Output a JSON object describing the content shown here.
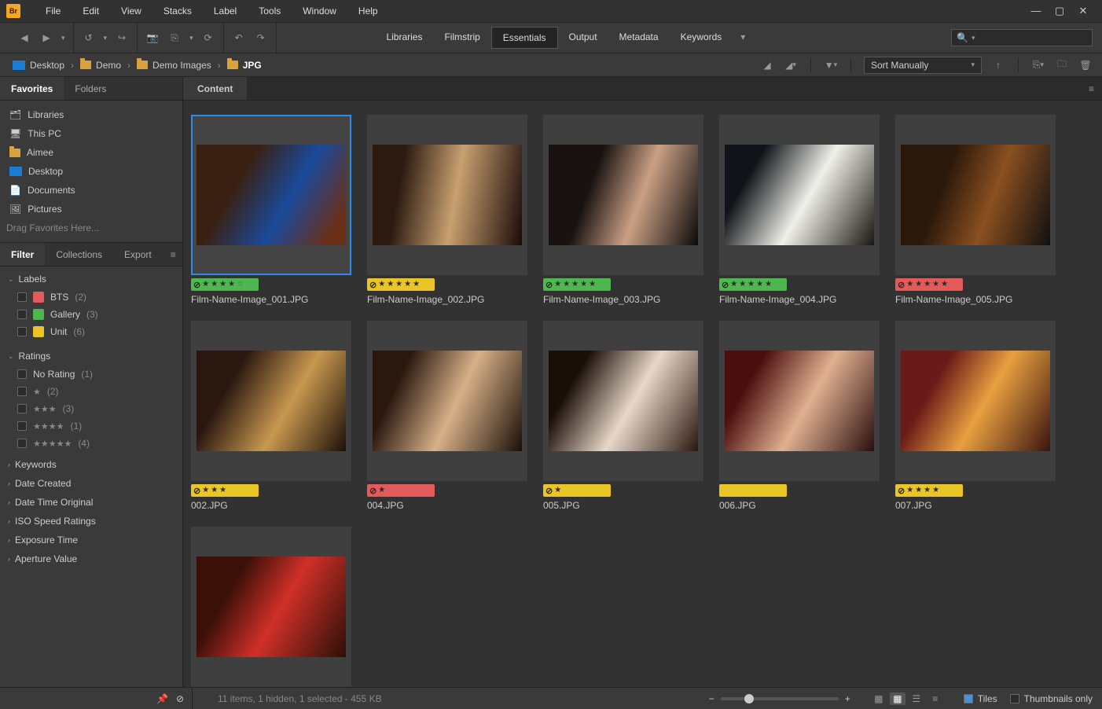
{
  "menubar": {
    "items": [
      "File",
      "Edit",
      "View",
      "Stacks",
      "Label",
      "Tools",
      "Window",
      "Help"
    ]
  },
  "workspaces": {
    "items": [
      "Libraries",
      "Filmstrip",
      "Essentials",
      "Output",
      "Metadata",
      "Keywords"
    ],
    "active": "Essentials"
  },
  "breadcrumb": [
    {
      "icon": "desktop",
      "label": "Desktop"
    },
    {
      "icon": "folder",
      "label": "Demo"
    },
    {
      "icon": "folder",
      "label": "Demo Images"
    },
    {
      "icon": "folder",
      "label": "JPG"
    }
  ],
  "sort": {
    "value": "Sort Manually"
  },
  "left": {
    "tabs": [
      "Favorites",
      "Folders"
    ],
    "active": "Favorites",
    "favorites": [
      {
        "icon": "libraries",
        "label": "Libraries"
      },
      {
        "icon": "pc",
        "label": "This PC"
      },
      {
        "icon": "folder",
        "label": "Aimee"
      },
      {
        "icon": "desktop",
        "label": "Desktop"
      },
      {
        "icon": "doc",
        "label": "Documents"
      },
      {
        "icon": "pic",
        "label": "Pictures"
      }
    ],
    "drag_hint": "Drag Favorites Here...",
    "filter_tabs": [
      "Filter",
      "Collections",
      "Export"
    ],
    "filter_active": "Filter",
    "labels_header": "Labels",
    "labels": [
      {
        "color": "#e25a5a",
        "name": "BTS",
        "count": "(2)"
      },
      {
        "color": "#4eb84e",
        "name": "Gallery",
        "count": "(3)"
      },
      {
        "color": "#e9c528",
        "name": "Unit",
        "count": "(6)"
      }
    ],
    "ratings_header": "Ratings",
    "ratings": [
      {
        "label": "No Rating",
        "count": "(1)",
        "stars": 0
      },
      {
        "label": "★",
        "count": "(2)",
        "stars": 1
      },
      {
        "label": "★★★",
        "count": "(3)",
        "stars": 3
      },
      {
        "label": "★★★★",
        "count": "(1)",
        "stars": 4
      },
      {
        "label": "★★★★★",
        "count": "(4)",
        "stars": 5
      }
    ],
    "extra_sections": [
      "Keywords",
      "Date Created",
      "Date Time Original",
      "ISO Speed Ratings",
      "Exposure Time",
      "Aperture Value"
    ]
  },
  "content": {
    "tab": "Content",
    "items": [
      {
        "selected": true,
        "label_color": "green",
        "stars": 4,
        "reject": true,
        "name": "Film-Name-Image_001.JPG",
        "img": "img1"
      },
      {
        "label_color": "yellow",
        "stars": 5,
        "reject": true,
        "name": "Film-Name-Image_002.JPG",
        "img": "img2"
      },
      {
        "label_color": "green",
        "stars": 5,
        "reject": true,
        "name": "Film-Name-Image_003.JPG",
        "img": "img3"
      },
      {
        "label_color": "green",
        "stars": 5,
        "reject": true,
        "name": "Film-Name-Image_004.JPG",
        "img": "img4"
      },
      {
        "label_color": "red",
        "stars": 5,
        "reject": true,
        "name": "Film-Name-Image_005.JPG",
        "img": "img5"
      },
      {
        "label_color": "yellow",
        "stars": 3,
        "reject": true,
        "name": "002.JPG",
        "img": "img6"
      },
      {
        "label_color": "red",
        "stars": 1,
        "reject": true,
        "name": "004.JPG",
        "img": "img7"
      },
      {
        "label_color": "yellow",
        "stars": 1,
        "reject": true,
        "name": "005.JPG",
        "img": "img8"
      },
      {
        "label_color": "yellow",
        "stars": 0,
        "reject": false,
        "name": "006.JPG",
        "img": "img9"
      },
      {
        "label_color": "yellow",
        "stars": 4,
        "reject": true,
        "name": "007.JPG",
        "img": "img10"
      },
      {
        "label_color": "",
        "stars": 0,
        "reject": false,
        "name": "",
        "img": "img11"
      }
    ]
  },
  "status": {
    "text": "11 items, 1 hidden, 1 selected - 455 KB"
  },
  "bottom": {
    "tiles": "Tiles",
    "thumbs_only": "Thumbnails only"
  }
}
